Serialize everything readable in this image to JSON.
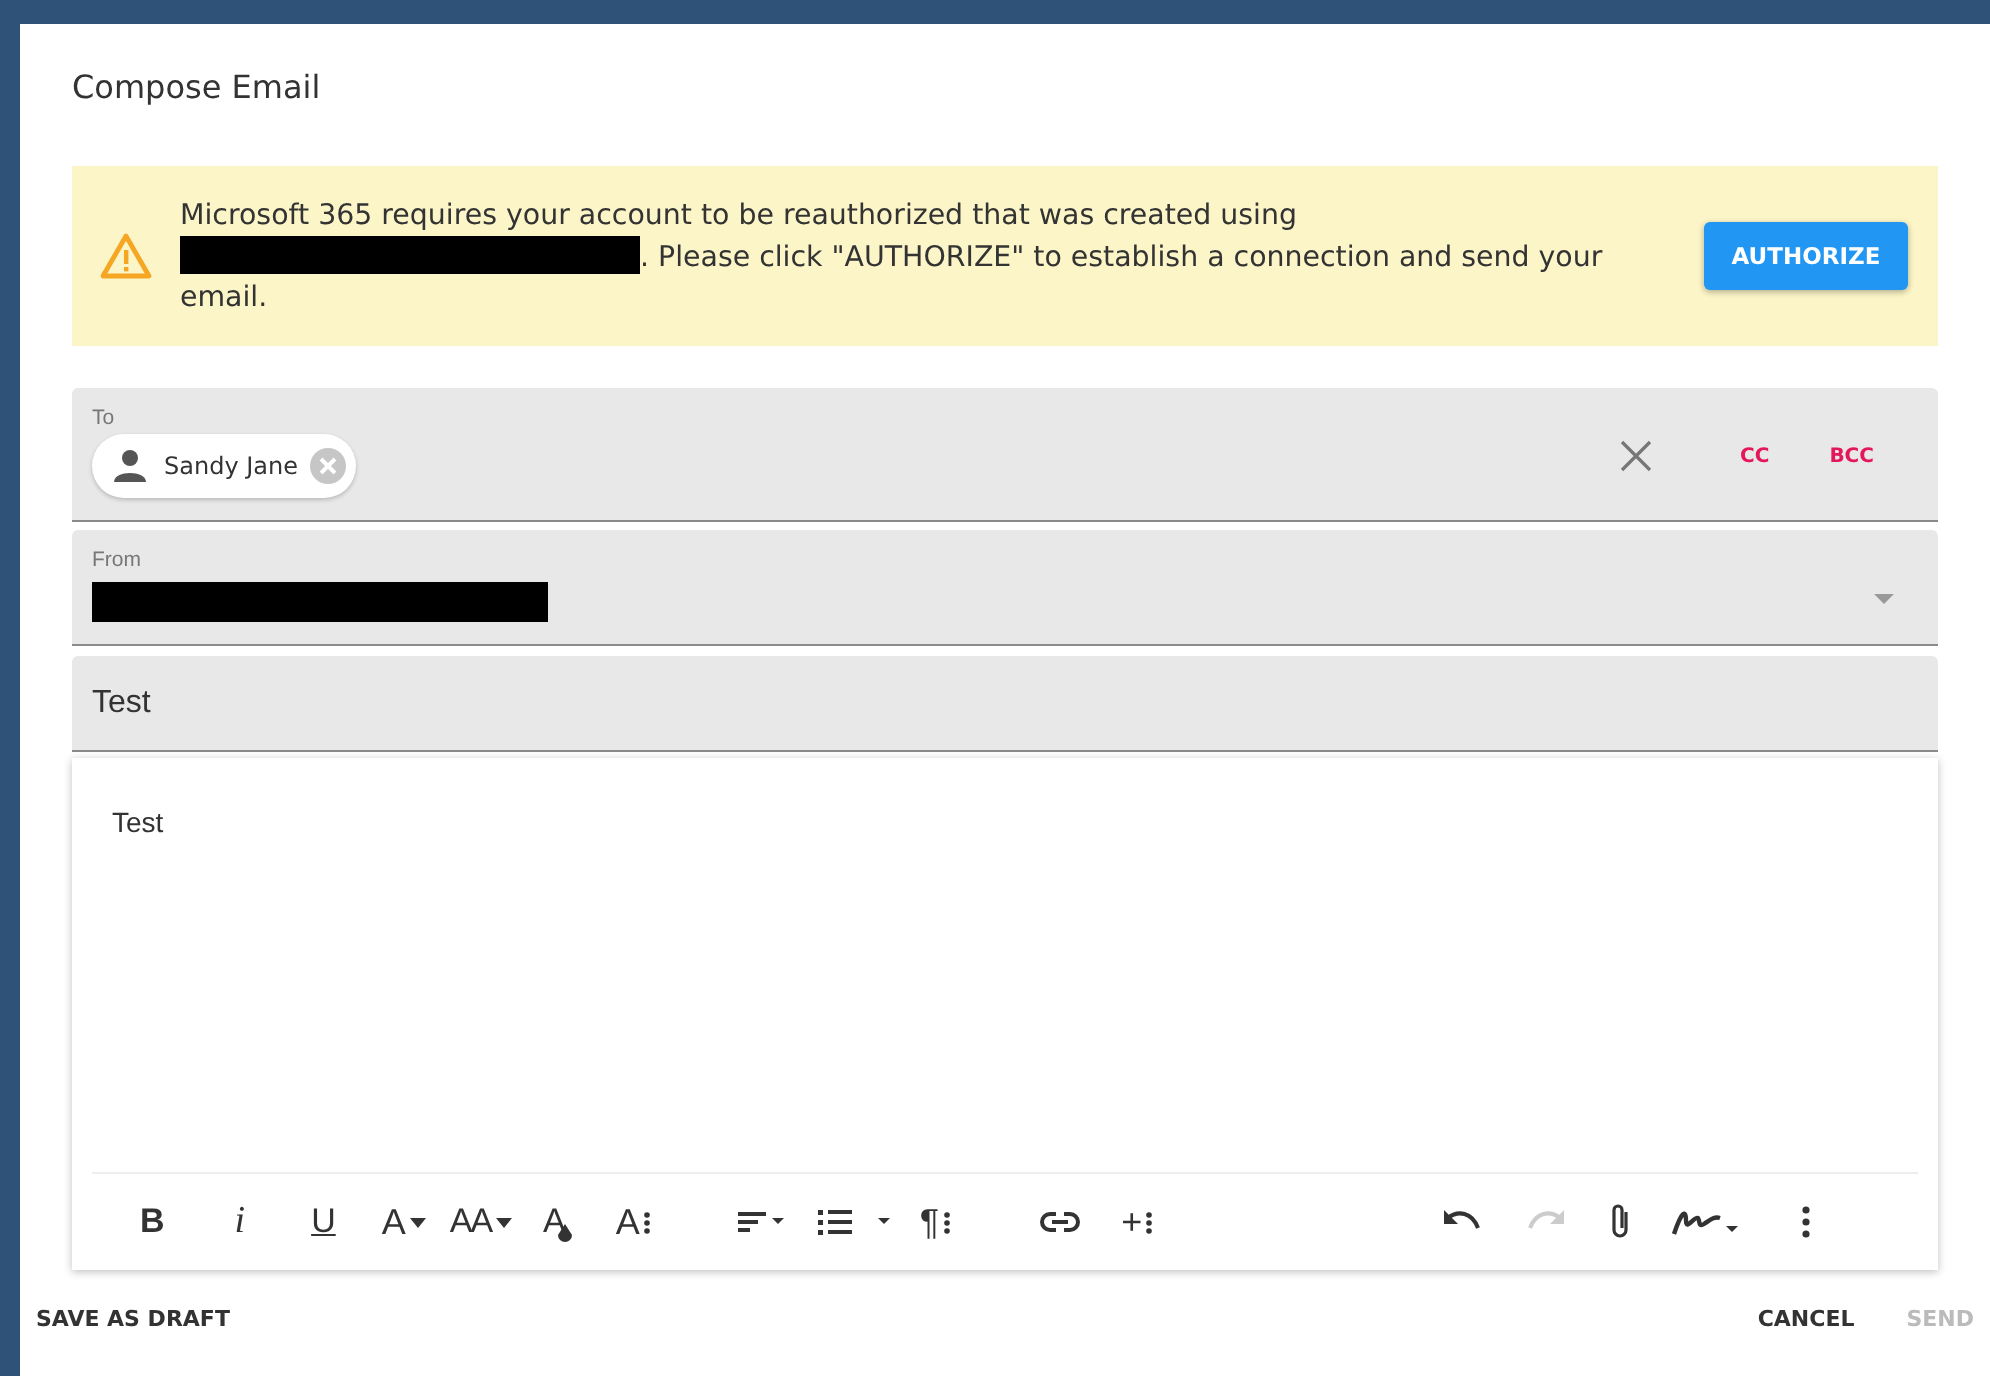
{
  "dialog": {
    "title": "Compose Email"
  },
  "alert": {
    "lines": [
      [
        {
          "kind": "text",
          "text": "Microsoft 365 requires your account to be reauthorized that was created using"
        }
      ],
      [
        {
          "kind": "redacted"
        },
        {
          "kind": "text",
          "text": ". Please click \"AUTHORIZE\" to establish a connection and send your"
        }
      ],
      [
        {
          "kind": "text",
          "text": "email."
        }
      ]
    ],
    "button": "AUTHORIZE"
  },
  "to": {
    "label": "To",
    "recipients": [
      {
        "name": "Sandy Jane"
      }
    ],
    "cc": "CC",
    "bcc": "BCC"
  },
  "from": {
    "label": "From",
    "value_redacted": true
  },
  "subject": {
    "value": "Test"
  },
  "body": {
    "text": "Test"
  },
  "toolbar": [
    {
      "kind": "bold",
      "label": "B"
    },
    {
      "kind": "italic",
      "label": "i"
    },
    {
      "kind": "underline",
      "label": "U"
    },
    {
      "kind": "font-color",
      "label": "A"
    },
    {
      "kind": "font-size",
      "label": "AA"
    },
    {
      "kind": "highlight",
      "label": "A"
    },
    {
      "kind": "text-more",
      "label": "A"
    },
    {
      "kind": "align"
    },
    {
      "kind": "list"
    },
    {
      "kind": "paragraph",
      "label": "¶"
    },
    {
      "kind": "link"
    },
    {
      "kind": "insert",
      "label": "+"
    },
    {
      "kind": "undo",
      "disabled": false
    },
    {
      "kind": "redo",
      "disabled": true
    },
    {
      "kind": "attach"
    },
    {
      "kind": "signature"
    },
    {
      "kind": "more"
    }
  ],
  "footer": {
    "draft": "SAVE AS DRAFT",
    "cancel": "CANCEL",
    "send": {
      "label": "SEND",
      "disabled": true
    }
  }
}
